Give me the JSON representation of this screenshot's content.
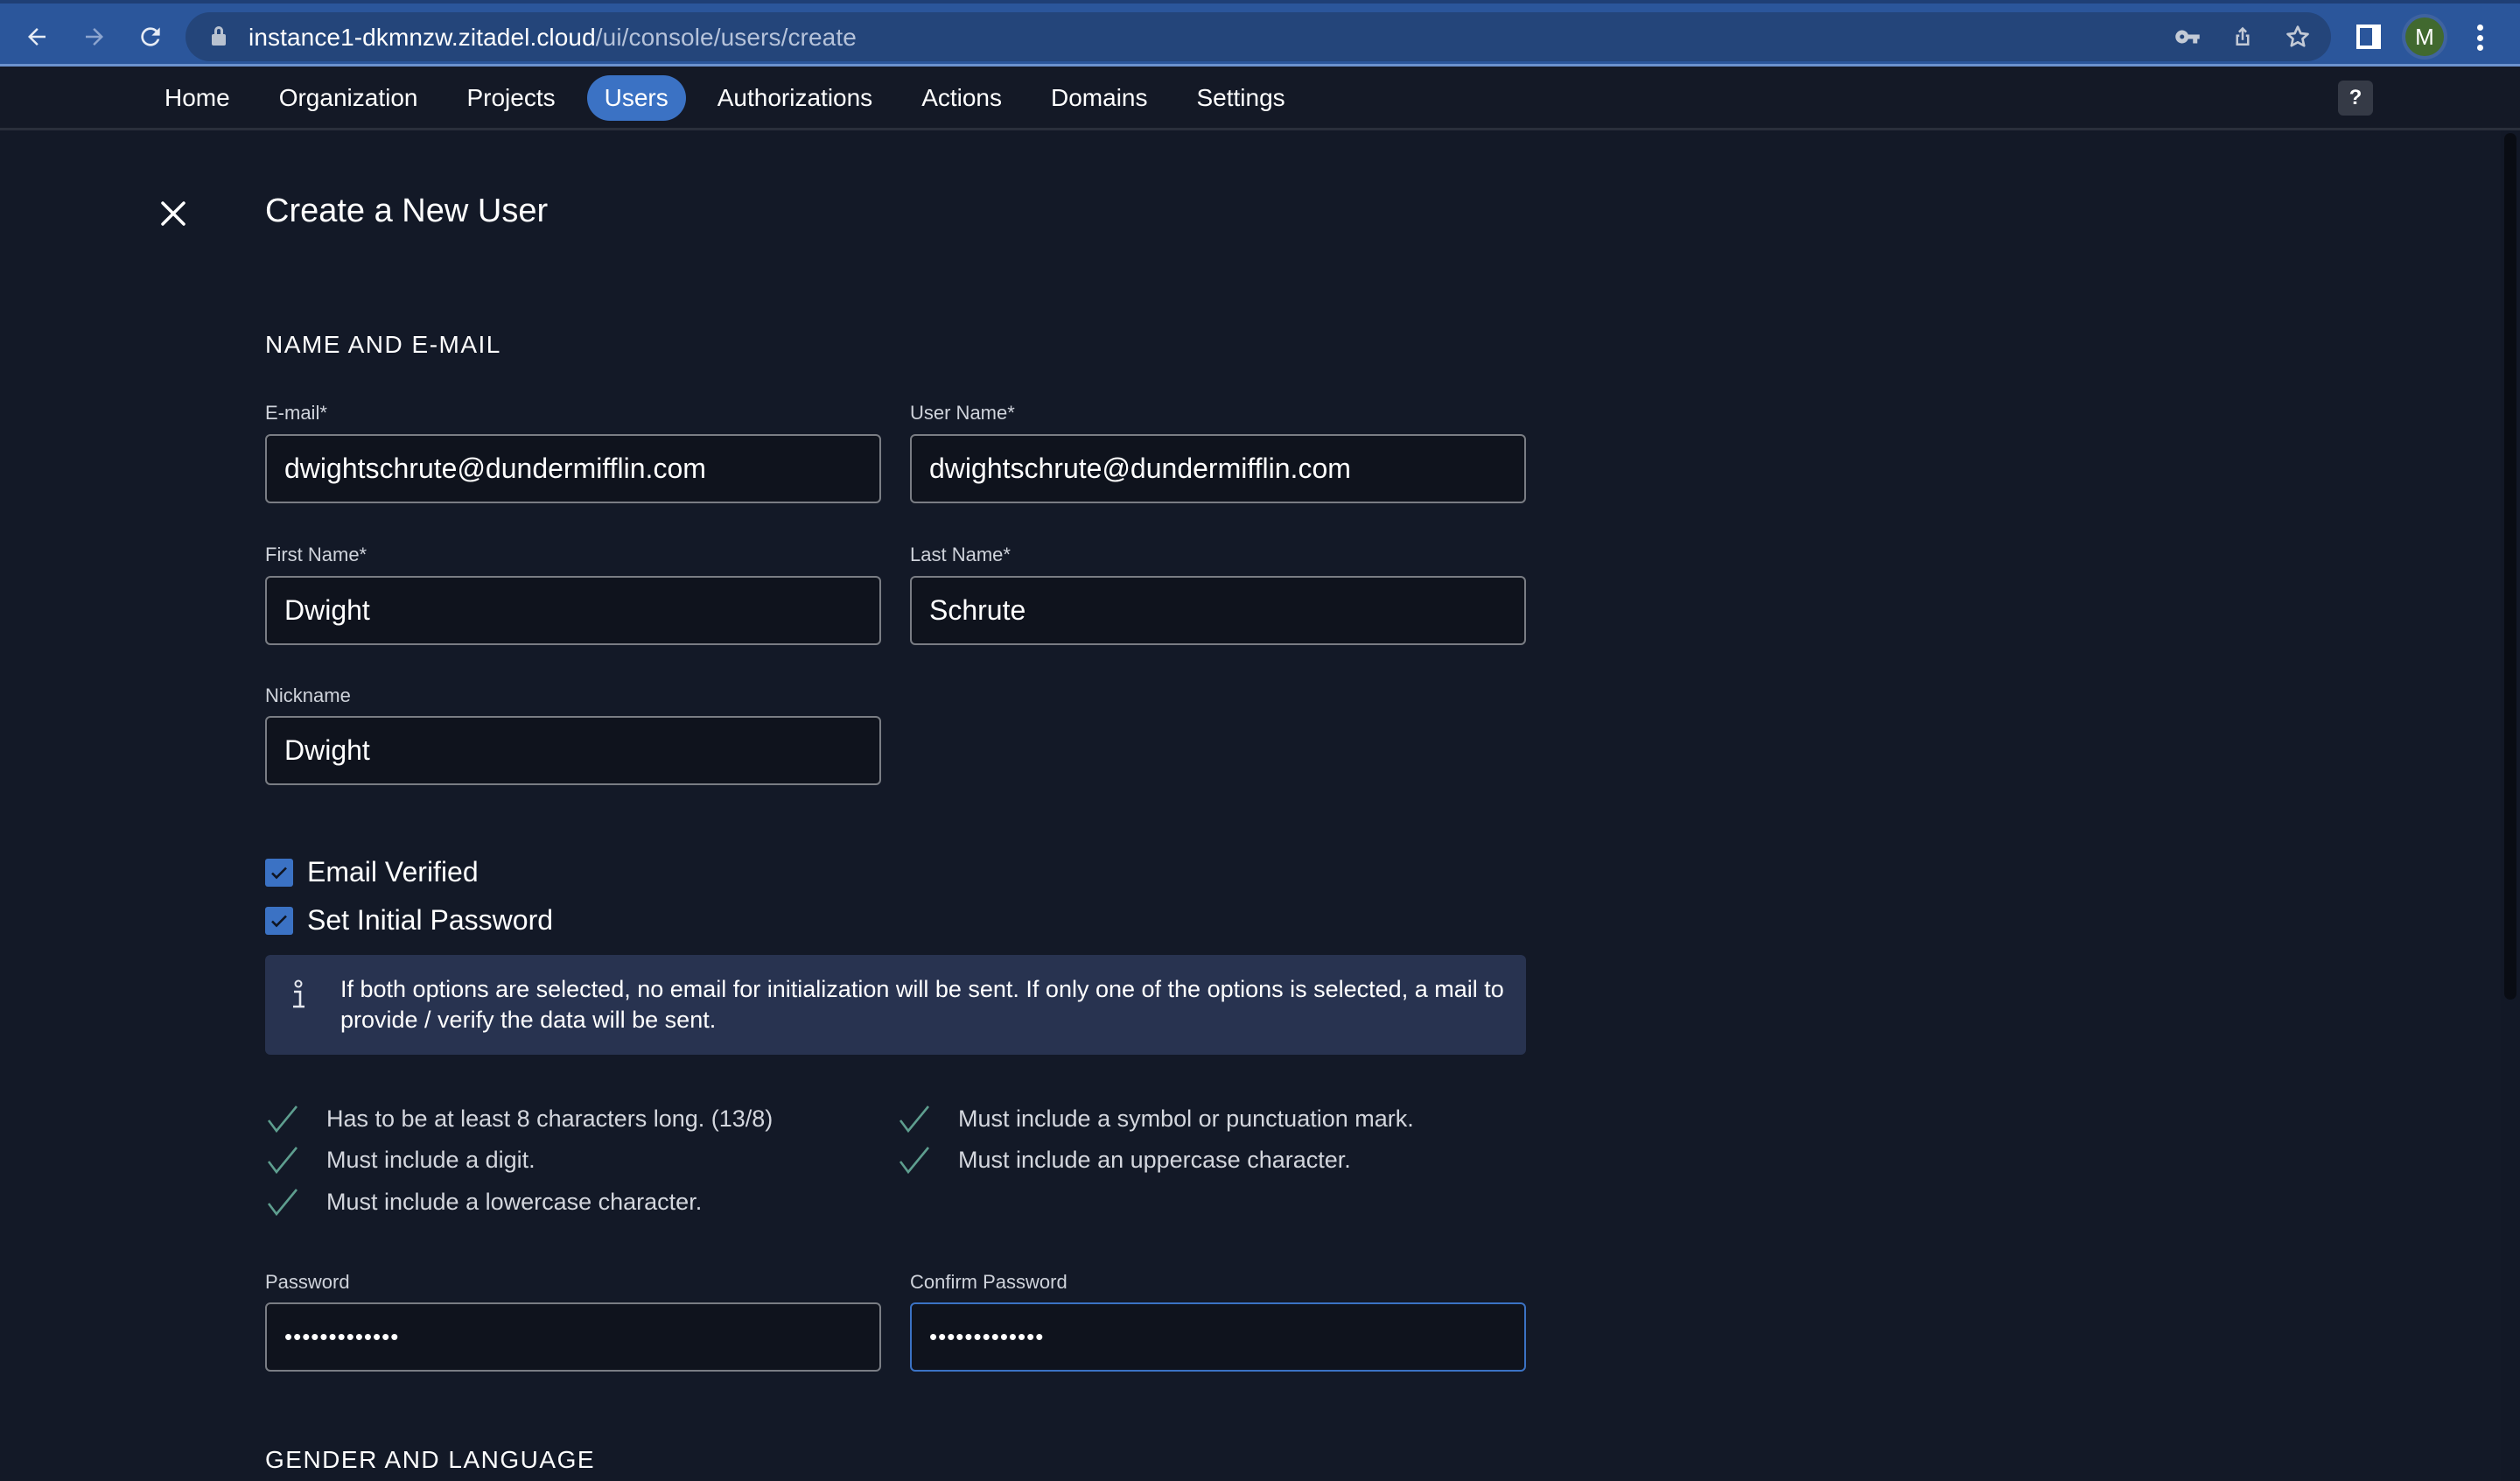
{
  "browser": {
    "url_host": "instance1-dkmnzw.zitadel.cloud",
    "url_path": "/ui/console/users/create",
    "profile_initial": "M",
    "icons": [
      "back-arrow-icon",
      "forward-arrow-icon",
      "reload-icon",
      "lock-icon",
      "key-icon",
      "share-icon",
      "star-icon",
      "side-panel-icon",
      "profile-avatar",
      "more-vert-icon"
    ]
  },
  "nav": {
    "items": [
      {
        "label": "Home",
        "active": false
      },
      {
        "label": "Organization",
        "active": false
      },
      {
        "label": "Projects",
        "active": false
      },
      {
        "label": "Users",
        "active": true
      },
      {
        "label": "Authorizations",
        "active": false
      },
      {
        "label": "Actions",
        "active": false
      },
      {
        "label": "Domains",
        "active": false
      },
      {
        "label": "Settings",
        "active": false
      }
    ],
    "help_label": "?"
  },
  "page": {
    "title": "Create a New User",
    "close_icon": "close-icon"
  },
  "sections": {
    "name_email": "NAME AND E-MAIL",
    "gender_language": "GENDER AND LANGUAGE"
  },
  "form": {
    "email": {
      "label": "E-mail*",
      "value": "dwightschrute@dundermifflin.com"
    },
    "username": {
      "label": "User Name*",
      "value": "dwightschrute@dundermifflin.com"
    },
    "first_name": {
      "label": "First Name*",
      "value": "Dwight"
    },
    "last_name": {
      "label": "Last Name*",
      "value": "Schrute"
    },
    "nickname": {
      "label": "Nickname",
      "value": "Dwight"
    },
    "email_verified": {
      "label": "Email Verified",
      "checked": true
    },
    "set_initial_password": {
      "label": "Set Initial Password",
      "checked": true
    },
    "info": "If both options are selected, no email for initialization will be sent. If only one of the options is selected, a mail to provide / verify the data will be sent.",
    "password_rules": [
      {
        "text": "Has to be at least 8 characters long. (13/8)",
        "met": true
      },
      {
        "text": "Must include a symbol or punctuation mark.",
        "met": true
      },
      {
        "text": "Must include a digit.",
        "met": true
      },
      {
        "text": "Must include an uppercase character.",
        "met": true
      },
      {
        "text": "Must include a lowercase character.",
        "met": true
      }
    ],
    "password": {
      "label": "Password",
      "value": "•••••••••••••"
    },
    "confirm_password": {
      "label": "Confirm Password",
      "value": "•••••••••••••"
    }
  },
  "colors": {
    "accent": "#3b72c4",
    "background": "#131927",
    "info_box": "#283350",
    "check_green": "#5e9e8f",
    "browser_bar": "#2b569b"
  }
}
